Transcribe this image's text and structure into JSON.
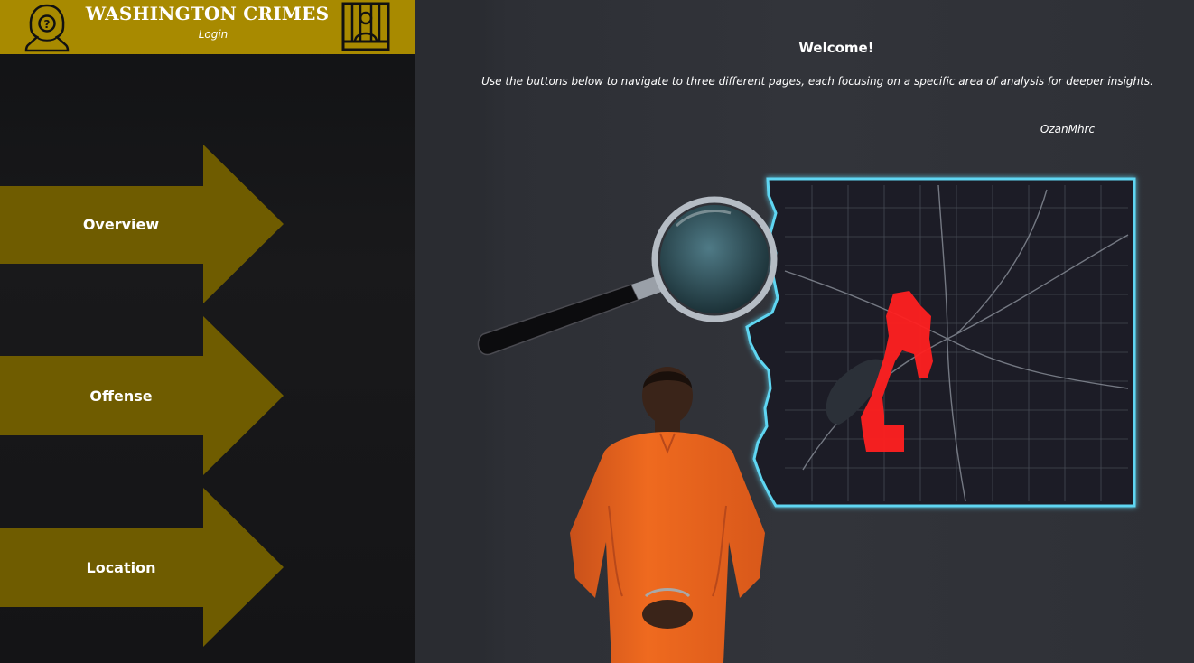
{
  "header": {
    "title": "WASHINGTON CRIMES",
    "subtitle": "Login",
    "left_icon": "hooded-suspect-icon",
    "right_icon": "jail-prisoner-icon",
    "color": "#a88a00"
  },
  "nav": {
    "items": [
      {
        "label": "Overview"
      },
      {
        "label": "Offense"
      },
      {
        "label": "Location"
      }
    ],
    "arrow_color": "#6f5c00"
  },
  "main": {
    "welcome": "Welcome!",
    "description": "Use the buttons below to navigate to three different pages, each focusing on a specific area of analysis for deeper insights.",
    "author": "OzanMhrc"
  },
  "colors": {
    "map_glow": "#5fd6f2",
    "highlight": "#ff2020",
    "jumpsuit": "#ef6a1f"
  }
}
